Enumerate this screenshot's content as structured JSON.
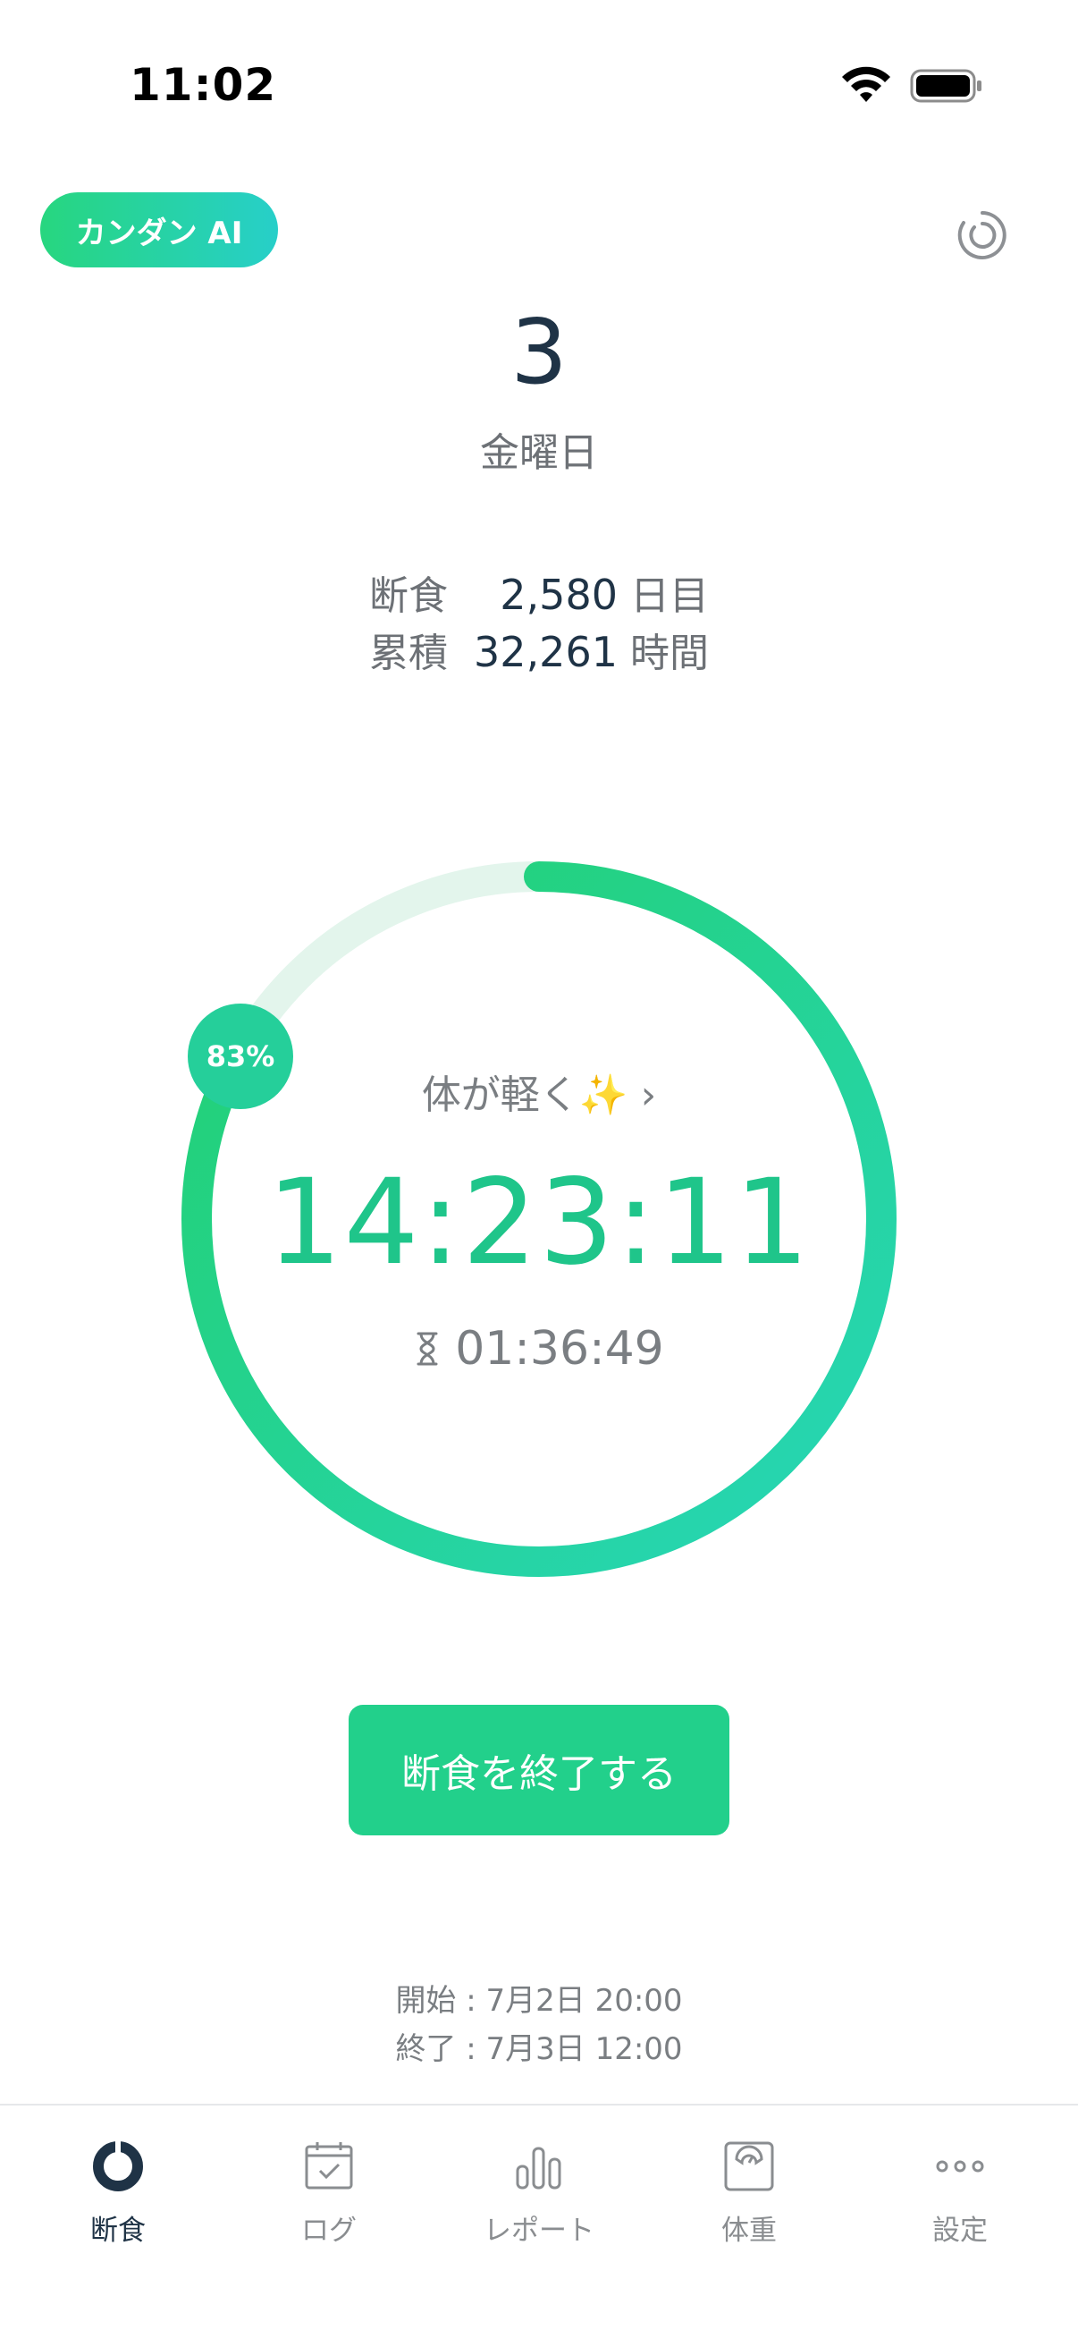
{
  "status_bar": {
    "time": "11:02"
  },
  "header": {
    "ai_button_label": "カンダン AI",
    "date_number": "3",
    "weekday": "金曜日"
  },
  "stats": {
    "fasting": {
      "label": "断食",
      "value": "2,580",
      "unit": "日目"
    },
    "total": {
      "label": "累積",
      "value": "32,261",
      "unit": "時間"
    }
  },
  "timer": {
    "progress_percent": 83,
    "percent_label": "83%",
    "message": "体が軽く✨ ›",
    "elapsed": "14:23:11",
    "remaining": "01:36:49",
    "colors": {
      "progress": "#22d08b",
      "track": "#e3f5ec",
      "text": "#1fc58a"
    }
  },
  "action": {
    "end_button_label": "断食を終了する"
  },
  "schedule": {
    "start": "開始 : 7月2日 20:00",
    "end": "終了 : 7月3日 12:00"
  },
  "tabs": [
    {
      "label": "断食",
      "icon": "fasting-ring-icon",
      "active": true
    },
    {
      "label": "ログ",
      "icon": "calendar-check-icon",
      "active": false
    },
    {
      "label": "レポート",
      "icon": "bar-chart-icon",
      "active": false
    },
    {
      "label": "体重",
      "icon": "scale-icon",
      "active": false
    },
    {
      "label": "設定",
      "icon": "more-dots-icon",
      "active": false
    }
  ]
}
